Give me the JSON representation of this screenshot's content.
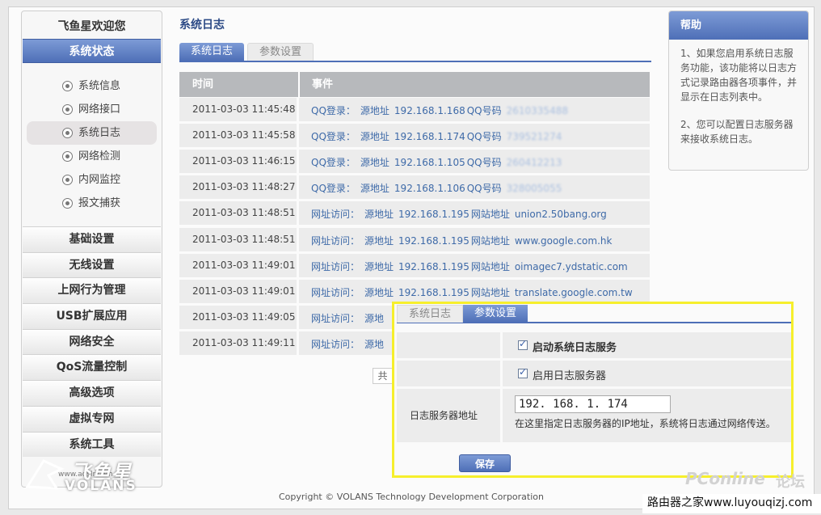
{
  "sidebar": {
    "welcome": "飞鱼星欢迎您",
    "active_section": "系统状态",
    "sub_items": [
      {
        "label": "系统信息"
      },
      {
        "label": "网络接口"
      },
      {
        "label": "系统日志",
        "active": true
      },
      {
        "label": "网络检测"
      },
      {
        "label": "内网监控"
      },
      {
        "label": "报文捕获"
      }
    ],
    "sections": [
      "基础设置",
      "无线设置",
      "上网行为管理",
      "USB扩展应用",
      "网络安全",
      "QoS流量控制",
      "高级选项",
      "虚拟专网",
      "系统工具"
    ]
  },
  "logo": {
    "brand_cn": "飞鱼星",
    "brand_en": "VOLANS",
    "url": "www.adslr.com"
  },
  "main": {
    "title": "系统日志",
    "tabs": [
      {
        "label": "系统日志",
        "active": true
      },
      {
        "label": "参数设置",
        "active": false
      }
    ],
    "table": {
      "headers": {
        "time": "时间",
        "event": "事件"
      },
      "rows": [
        {
          "time": "2011-03-03 11:45:48",
          "type": "QQ登录：",
          "src_label": "源地址",
          "ip": "192.168.1.168",
          "key": "QQ号码",
          "value": "2610335488",
          "blurred": true
        },
        {
          "time": "2011-03-03 11:45:58",
          "type": "QQ登录：",
          "src_label": "源地址",
          "ip": "192.168.1.174",
          "key": "QQ号码",
          "value": "739521274",
          "blurred": true
        },
        {
          "time": "2011-03-03 11:46:15",
          "type": "QQ登录：",
          "src_label": "源地址",
          "ip": "192.168.1.105",
          "key": "QQ号码",
          "value": "260412213",
          "blurred": true
        },
        {
          "time": "2011-03-03 11:48:27",
          "type": "QQ登录：",
          "src_label": "源地址",
          "ip": "192.168.1.106",
          "key": "QQ号码",
          "value": "328005055",
          "blurred": true
        },
        {
          "time": "2011-03-03 11:48:51",
          "type": "网址访问：",
          "src_label": "源地址",
          "ip": "192.168.1.195",
          "key": "网站地址",
          "value": "union2.50bang.org",
          "blurred": false
        },
        {
          "time": "2011-03-03 11:48:51",
          "type": "网址访问：",
          "src_label": "源地址",
          "ip": "192.168.1.195",
          "key": "网站地址",
          "value": "www.google.com.hk",
          "blurred": false
        },
        {
          "time": "2011-03-03 11:49:01",
          "type": "网址访问：",
          "src_label": "源地址",
          "ip": "192.168.1.195",
          "key": "网站地址",
          "value": "oimagec7.ydstatic.com",
          "blurred": false
        },
        {
          "time": "2011-03-03 11:49:01",
          "type": "网址访问：",
          "src_label": "源地址",
          "ip": "192.168.1.195",
          "key": "网站地址",
          "value": "translate.google.com.tw",
          "blurred": false
        },
        {
          "time": "2011-03-03 11:49:05",
          "type": "网址访问：",
          "src_label": "源地",
          "ip": "",
          "key": "",
          "value": "",
          "blurred": false
        },
        {
          "time": "2011-03-03 11:49:11",
          "type": "网址访问：",
          "src_label": "源地",
          "ip": "",
          "key": "",
          "value": "",
          "blurred": false
        }
      ]
    },
    "pager_text": "共"
  },
  "help": {
    "title": "帮助",
    "paragraphs": [
      "1、如果您启用系统日志服务功能，该功能将以日志方式记录路由器各项事件，并显示在日志列表中。",
      "2、您可以配置日志服务器来接收系统日志。"
    ]
  },
  "settings_panel": {
    "tabs": [
      {
        "label": "系统日志",
        "active": false
      },
      {
        "label": "参数设置",
        "active": true
      }
    ],
    "enable_log_label": "启动系统日志服务",
    "enable_log_checked": true,
    "enable_server_label": "启用日志服务器",
    "enable_server_checked": true,
    "server_addr_label": "日志服务器地址",
    "server_addr_value": "192. 168. 1. 174",
    "server_addr_hint": "在这里指定日志服务器的IP地址，系统将日志通过网络传送。",
    "save_label": "保存"
  },
  "footer": {
    "copyright": "Copyright © VOLANS Technology Development Corporation"
  },
  "watermarks": {
    "pconline": "PConline",
    "forum": "论坛",
    "site": "路由器之家www.luyouqizj.com"
  },
  "colors": {
    "accent": "#4e6fb7",
    "highlight_border": "#f6ef2c",
    "link": "#3e6aa8"
  }
}
